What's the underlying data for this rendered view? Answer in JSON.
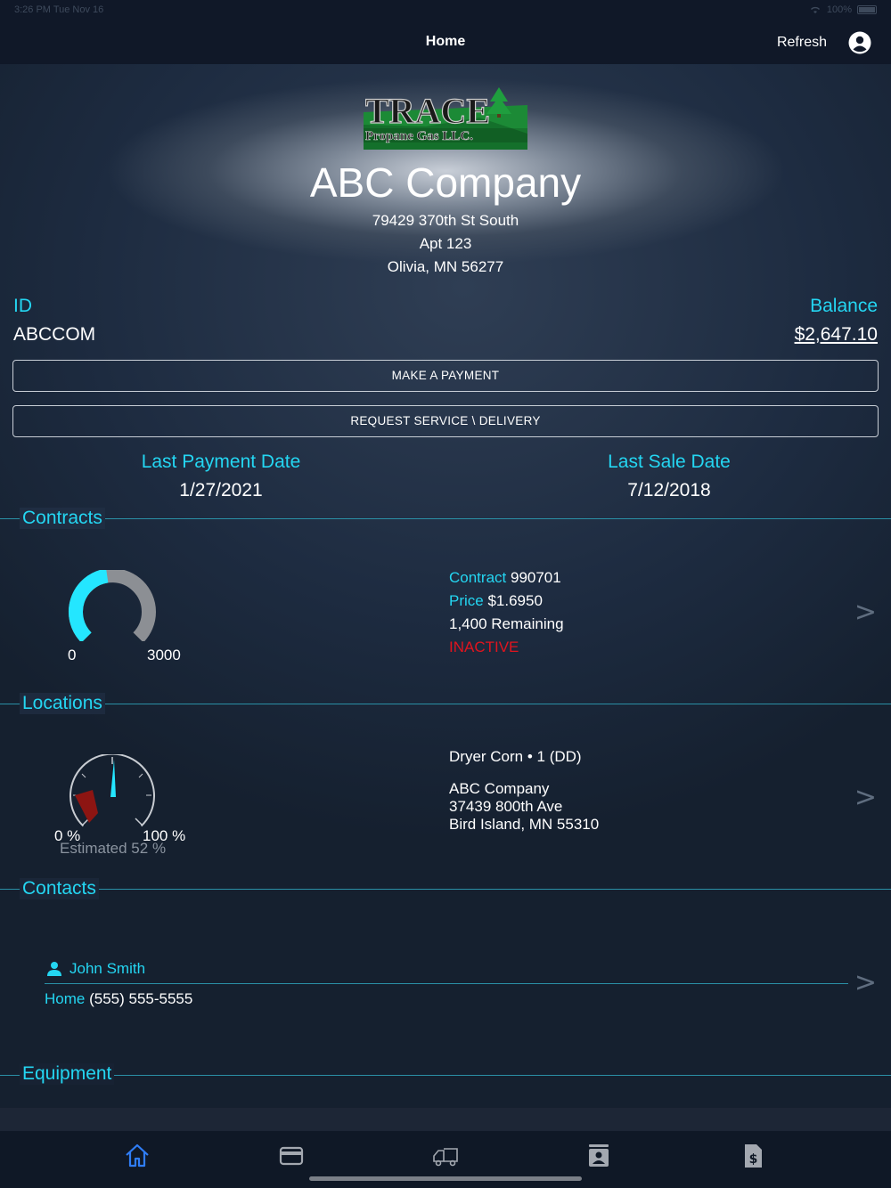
{
  "status_bar": {
    "time": "3:26 PM  Tue Nov 16",
    "battery": "100%"
  },
  "nav": {
    "title": "Home",
    "refresh": "Refresh",
    "account_icon": "account-circle-icon"
  },
  "company": {
    "logo_text_main": "TRACE",
    "logo_text_sub": "Propane Gas LLC.",
    "name": "ABC Company",
    "address_line1": "79429 370th St South",
    "address_line2": "Apt 123",
    "address_line3": "Olivia, MN 56277"
  },
  "account": {
    "id_label": "ID",
    "id_value": "ABCCOM",
    "balance_label": "Balance",
    "balance_value": "$2,647.10"
  },
  "buttons": {
    "payment": "MAKE A PAYMENT",
    "service": "REQUEST SERVICE \\ DELIVERY"
  },
  "dates": {
    "last_payment_label": "Last Payment Date",
    "last_payment_value": "1/27/2021",
    "last_sale_label": "Last Sale Date",
    "last_sale_value": "7/12/2018"
  },
  "contracts": {
    "title": "Contracts",
    "gauge_min": "0",
    "gauge_max": "3000",
    "gauge_used_fraction": 0.47,
    "contract_label": "Contract",
    "contract_value": "990701",
    "price_label": "Price",
    "price_value": "$1.6950",
    "remaining": "1,400 Remaining",
    "status": "INACTIVE"
  },
  "locations": {
    "title": "Locations",
    "gauge_min": "0 %",
    "gauge_max": "100 %",
    "estimated": "Estimated 52 %",
    "tank": "Dryer Corn • 1 (DD)",
    "addr_name": "ABC Company",
    "addr_street": "37439 800th Ave",
    "addr_city": "Bird Island, MN  55310"
  },
  "contacts": {
    "title": "Contacts",
    "name": "John Smith",
    "phone_label": "Home",
    "phone_value": "(555) 555-5555"
  },
  "equipment": {
    "title": "Equipment"
  },
  "tabs": [
    "home-icon",
    "credit-card-icon",
    "delivery-truck-icon",
    "contact-card-icon",
    "invoice-icon"
  ],
  "colors": {
    "accent": "#24d6f2",
    "active_tab": "#2f7df6",
    "inactive": "#e0141e"
  }
}
